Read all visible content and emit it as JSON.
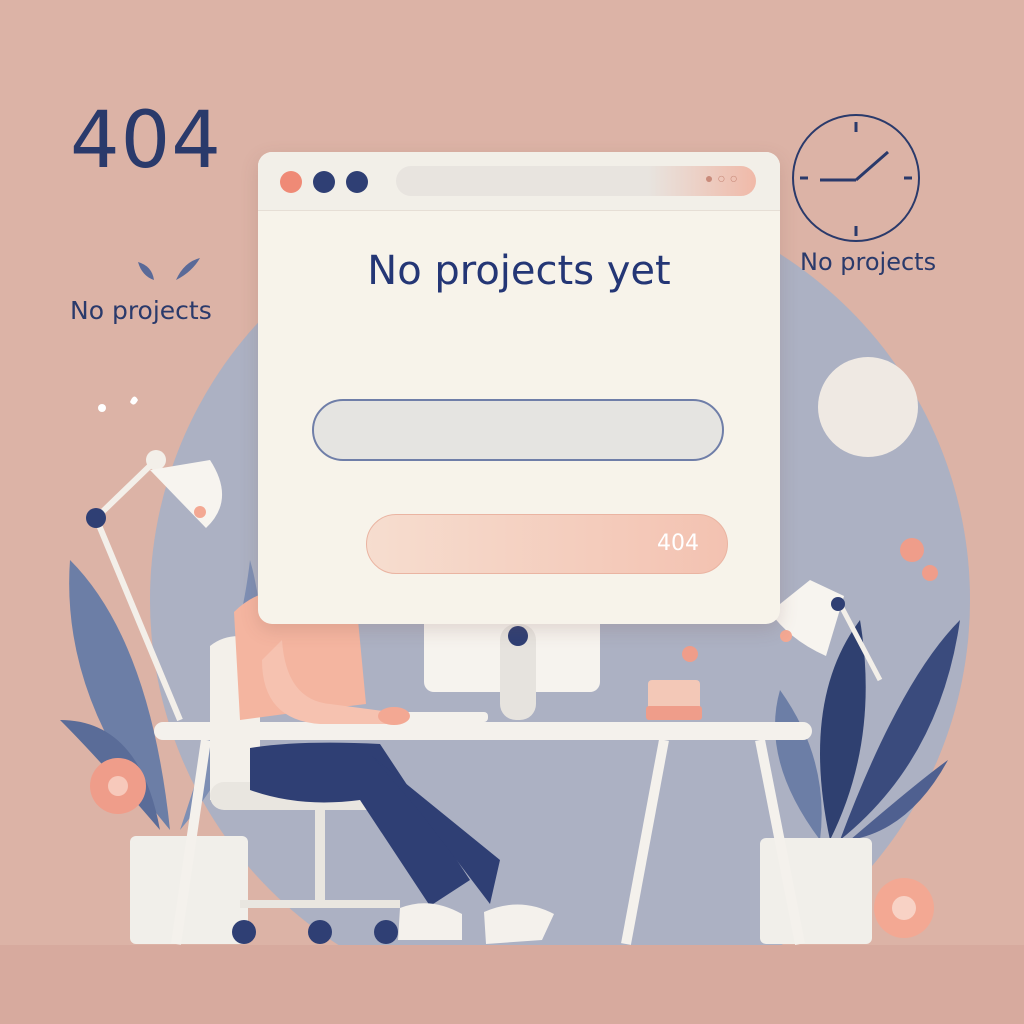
{
  "error": {
    "code": "404"
  },
  "labels": {
    "left": "No projects",
    "right": "No projects"
  },
  "browser": {
    "headline": "No projects yet",
    "button_code": "404"
  },
  "colors": {
    "background": "#dcb3a6",
    "navy": "#243675",
    "accent_pink": "#ef8a76",
    "slate_blue": "#8a9bbf",
    "window": "#f7f3ea"
  }
}
